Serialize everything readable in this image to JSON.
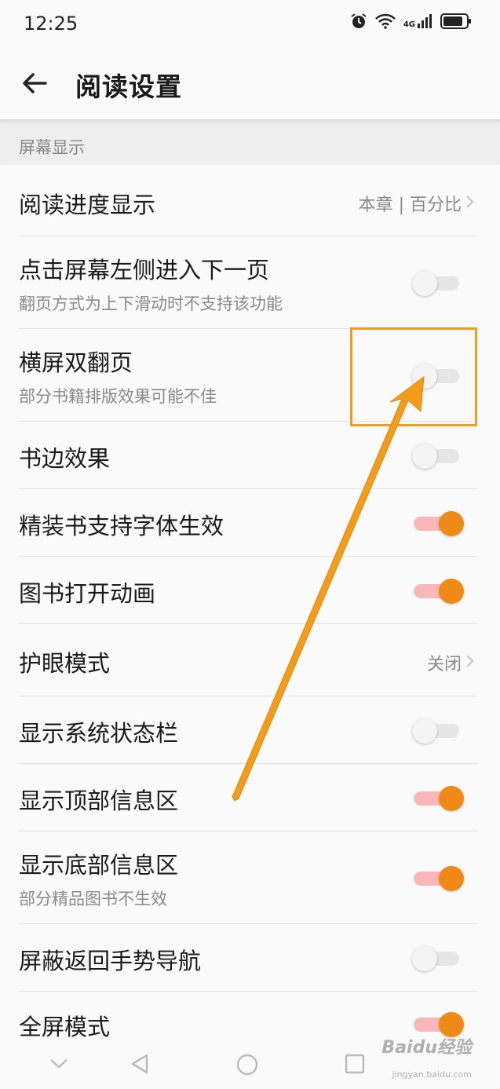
{
  "status_bar": {
    "time": "12:25",
    "network": "4G"
  },
  "header": {
    "title": "阅读设置"
  },
  "section": {
    "title": "屏幕显示"
  },
  "settings": [
    {
      "label": "阅读进度显示",
      "value": "本章 | 百分比"
    },
    {
      "label": "点击屏幕左侧进入下一页",
      "sub": "翻页方式为上下滑动时不支持该功能",
      "enabled": false
    },
    {
      "label": "横屏双翻页",
      "sub": "部分书籍排版效果可能不佳",
      "enabled": false
    },
    {
      "label": "书边效果",
      "enabled": false
    },
    {
      "label": "精装书支持字体生效",
      "enabled": true
    },
    {
      "label": "图书打开动画",
      "enabled": true
    },
    {
      "label": "护眼模式",
      "value": "关闭"
    },
    {
      "label": "显示系统状态栏",
      "enabled": false
    },
    {
      "label": "显示顶部信息区",
      "enabled": true
    },
    {
      "label": "显示底部信息区",
      "sub": "部分精品图书不生效",
      "enabled": true
    },
    {
      "label": "屏蔽返回手势导航",
      "enabled": false
    },
    {
      "label": "全屏模式",
      "enabled": true
    }
  ],
  "watermark": {
    "brand": "Baidu经验",
    "url": "jingyan.baidu.com"
  },
  "colors": {
    "accent": "#f08a16",
    "track_on": "#f8b8b8",
    "annotation": "#f29c1c"
  }
}
